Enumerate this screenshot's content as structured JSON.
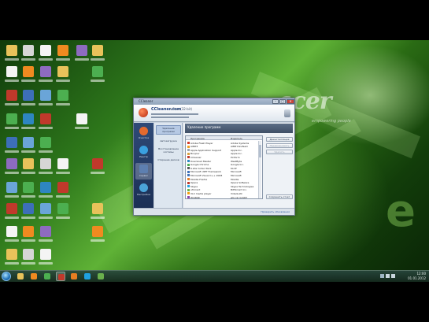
{
  "window": {
    "title": "CCleaner",
    "controls": {
      "minimize": "–",
      "maximize": "□",
      "close": "✕"
    }
  },
  "app": {
    "name": "CCleaner.com",
    "version": "v.3.xx (32-bit)",
    "sidebar": [
      {
        "label": "Очистка",
        "icon": "broom-icon",
        "color": "#e46a2e"
      },
      {
        "label": "Реестр",
        "icon": "registry-cubes-icon",
        "color": "#3aa0e0"
      },
      {
        "label": "Сервис",
        "icon": "toolbox-icon",
        "color": "#5d7fb0"
      },
      {
        "label": "Настройки",
        "icon": "gear-icon",
        "color": "#4aa3d8"
      }
    ],
    "subnav": [
      {
        "label": "Удаление программ",
        "active": true
      },
      {
        "label": "Автозагрузка",
        "active": false
      },
      {
        "label": "Восстановление системы",
        "active": false
      },
      {
        "label": "Стирание дисков",
        "active": false
      }
    ],
    "content": {
      "title": "Удаление программ",
      "subtitle": "Выберите программу из списка",
      "columns": [
        "Программа",
        "Издатель",
        "Дата"
      ],
      "rows": [
        {
          "name": "Adobe Flash Player",
          "publisher": "Adobe Systems",
          "color": "#d23b2a",
          "selected": false
        },
        {
          "name": "AIMP3",
          "publisher": "AIMP DevTeam",
          "color": "#f0a020",
          "selected": false
        },
        {
          "name": "Apple Application Support",
          "publisher": "Apple Inc.",
          "color": "#9aa4b0",
          "selected": false
        },
        {
          "name": "Bonjour",
          "publisher": "Apple Inc.",
          "color": "#d8a040",
          "selected": false
        },
        {
          "name": "CCleaner",
          "publisher": "Piriform",
          "color": "#c0392b",
          "selected": false
        },
        {
          "name": "Download Master",
          "publisher": "WestByte",
          "color": "#2e86c1",
          "selected": false
        },
        {
          "name": "Google Chrome",
          "publisher": "Google Inc.",
          "color": "#4caf50",
          "selected": false
        },
        {
          "name": "K-Lite Codec Pack",
          "publisher": "KLCP",
          "color": "#555555",
          "selected": false
        },
        {
          "name": "Microsoft .NET Framework",
          "publisher": "Microsoft",
          "color": "#3d6fb8",
          "selected": false
        },
        {
          "name": "Microsoft Visual C++ 2008",
          "publisher": "Microsoft",
          "color": "#3d6fb8",
          "selected": false
        },
        {
          "name": "Mozilla Firefox",
          "publisher": "Mozilla",
          "color": "#e67e22",
          "selected": false
        },
        {
          "name": "Opera",
          "publisher": "Opera Software",
          "color": "#c0392b",
          "selected": false
        },
        {
          "name": "Skype",
          "publisher": "Skype Technologies",
          "color": "#1fa1e0",
          "selected": false
        },
        {
          "name": "uTorrent",
          "publisher": "BitTorrent Inc.",
          "color": "#6ab04c",
          "selected": false
        },
        {
          "name": "VLC media player",
          "publisher": "VideoLAN",
          "color": "#f39c12",
          "selected": false
        },
        {
          "name": "WinRAR",
          "publisher": "win.rar GmbH",
          "color": "#8e44ad",
          "selected": false
        }
      ],
      "buttons": {
        "uninstall": "Деинсталляция",
        "rename": "Переименовать",
        "delete": "Удалить",
        "save": "Сохранить отчет"
      }
    },
    "status_link": "Проверить обновления"
  },
  "desktop": {
    "brand": "acer",
    "slogan": "empowering people",
    "overlay_letter": "e"
  },
  "taskbar": {
    "time": "12:00",
    "date": "01.01.2012",
    "pinned": [
      {
        "icon": "folder-icon",
        "color": "#e8c25a",
        "active": false
      },
      {
        "icon": "media-player-icon",
        "color": "#f08a20",
        "active": false
      },
      {
        "icon": "chrome-icon",
        "color": "#4caf50",
        "active": false
      },
      {
        "icon": "ccleaner-icon",
        "color": "#c0392b",
        "active": true
      },
      {
        "icon": "firefox-icon",
        "color": "#e67e22",
        "active": false
      },
      {
        "icon": "skype-icon",
        "color": "#1fa1e0",
        "active": false
      },
      {
        "icon": "torrent-icon",
        "color": "#6ab04c",
        "active": false
      }
    ]
  }
}
